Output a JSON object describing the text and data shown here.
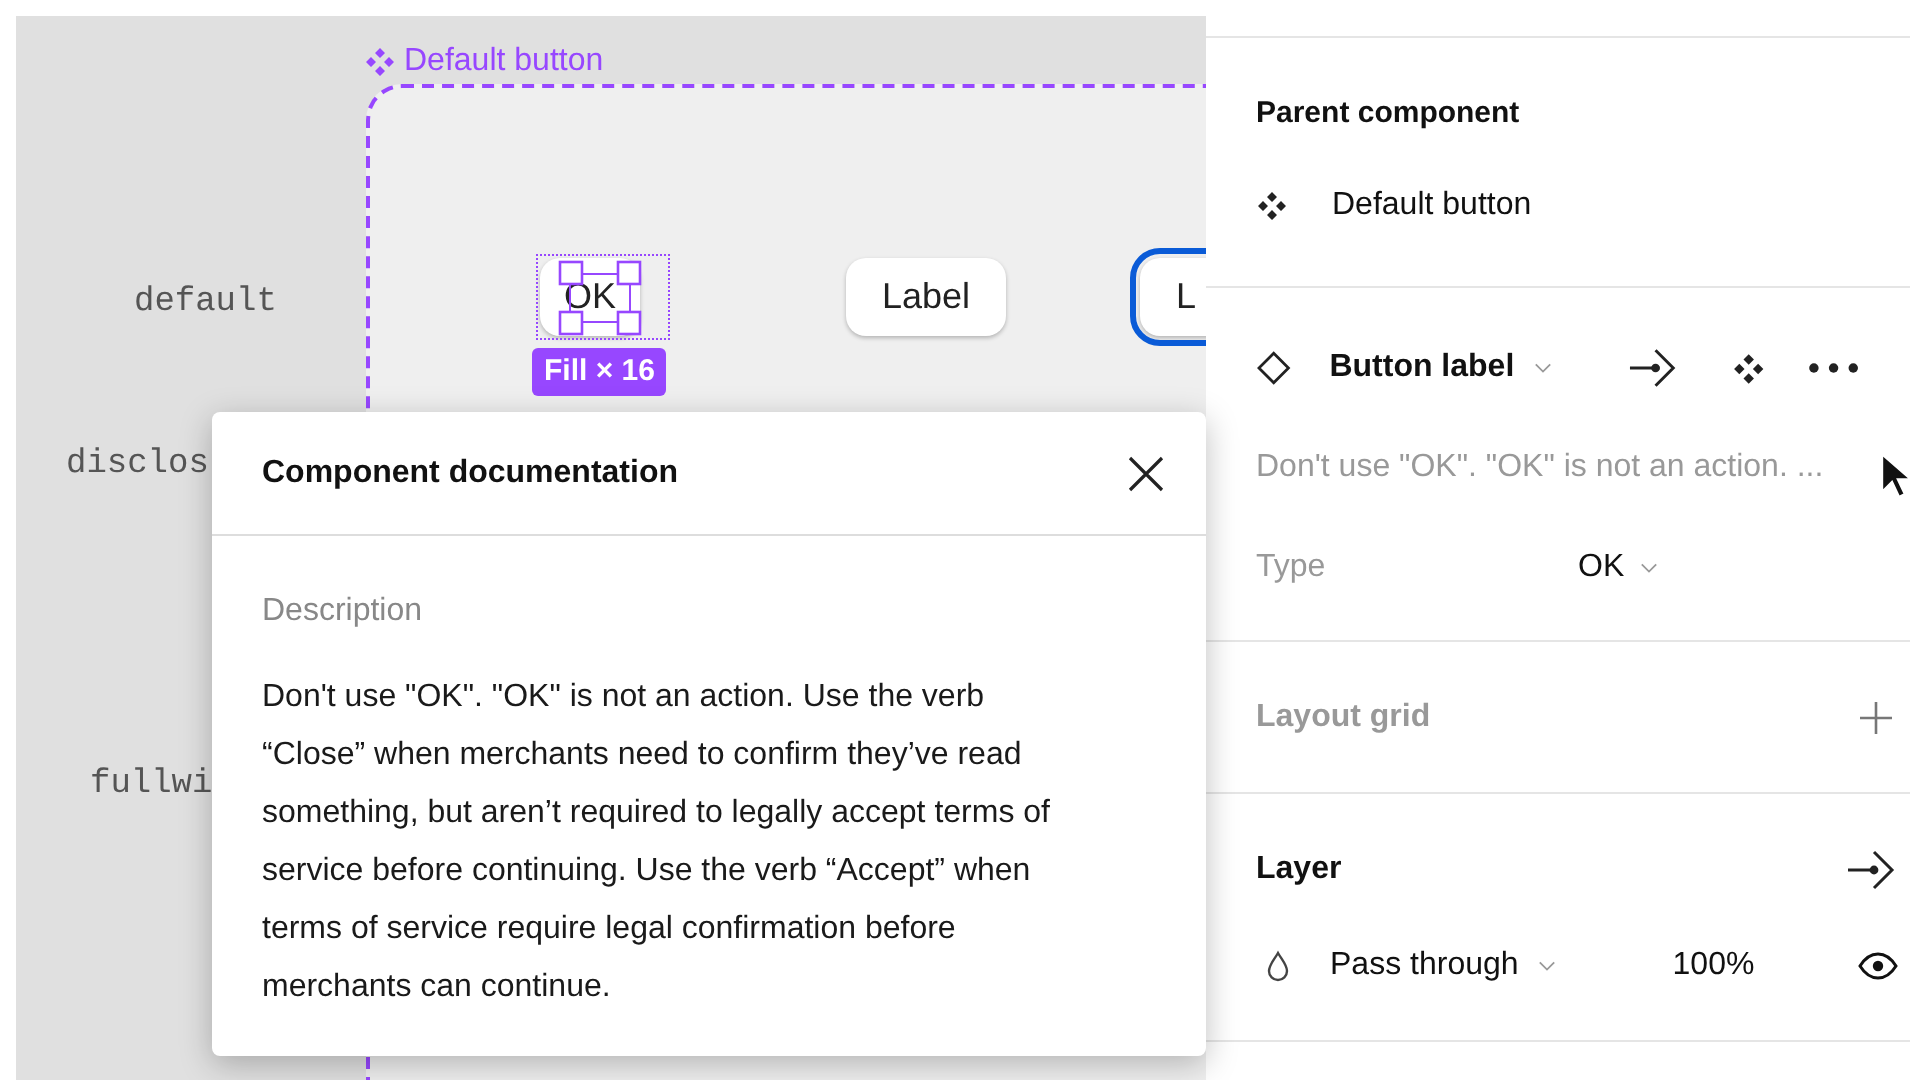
{
  "canvas": {
    "row_labels": [
      "default",
      "disclos",
      "fullwi"
    ],
    "component": {
      "title": "Default button",
      "buttons": [
        {
          "label": "OK",
          "selected": true,
          "badge": "Fill × 16"
        },
        {
          "label": "Label",
          "selected": false
        },
        {
          "label": "L",
          "selected": false,
          "focused": true
        }
      ]
    }
  },
  "documentation_popup": {
    "title": "Component documentation",
    "section_label": "Description",
    "text": "Don't use \"OK\". \"OK\" is not an action. Use the verb “Close” when merchants need to confirm they’ve read something, but aren’t required to legally accept terms of service before continuing. Use the verb “Accept” when terms of service require legal confirmation before merchants can continue."
  },
  "properties_panel": {
    "parent_component": {
      "heading": "Parent component",
      "name": "Default button"
    },
    "instance": {
      "name": "Button label",
      "description": "Don't use \"OK\". \"OK\" is not an action. ...",
      "properties": [
        {
          "label": "Type",
          "value": "OK"
        }
      ]
    },
    "layout_grid": {
      "heading": "Layout grid"
    },
    "layer": {
      "heading": "Layer",
      "blend_mode": "Pass through",
      "opacity": "100%"
    }
  }
}
